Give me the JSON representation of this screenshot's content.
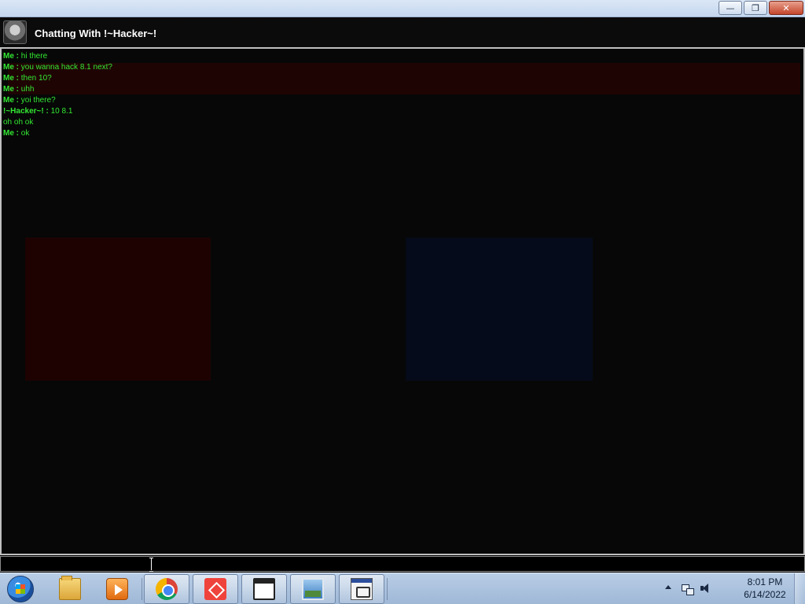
{
  "window": {
    "buttons": {
      "minimize": "—",
      "maximize": "❐",
      "close": "✕"
    }
  },
  "chat": {
    "title": "Chatting With !~Hacker~!",
    "messages": [
      {
        "sender": "Me :",
        "text": " hi there",
        "sender_color": "#32e832"
      },
      {
        "sender": "Me :",
        "text": " you wanna hack 8.1 next?",
        "sender_color": "#32e832"
      },
      {
        "sender": "Me :",
        "text": " then 10?",
        "sender_color": "#32e832"
      },
      {
        "sender": "Me :",
        "text": " uhh",
        "sender_color": "#32e832"
      },
      {
        "sender": "Me :",
        "text": " yoi there?",
        "sender_color": "#32e832"
      },
      {
        "sender": "!~Hacker~! :",
        "text": " 10 8.1",
        "sender_color": "#32e832"
      },
      {
        "sender": "",
        "text": "oh oh ok",
        "sender_color": "#32e832"
      },
      {
        "sender": "Me :",
        "text": " ok",
        "sender_color": "#32e832"
      }
    ],
    "input_value": "",
    "colors": {
      "message_text": "#32e832",
      "background": "#070707",
      "border": "#bfbfbf"
    }
  },
  "taskbar": {
    "items": [
      {
        "icon": "folder-icon",
        "active": false
      },
      {
        "icon": "media-player-icon",
        "active": false
      },
      {
        "icon": "chrome-icon",
        "active": true
      },
      {
        "icon": "anydesk-icon",
        "active": true
      },
      {
        "icon": "window-icon",
        "active": true
      },
      {
        "icon": "picture-icon",
        "active": true
      },
      {
        "icon": "exe-icon",
        "active": true
      }
    ],
    "clock": {
      "time": "8:01 PM",
      "date": "6/14/2022"
    }
  }
}
